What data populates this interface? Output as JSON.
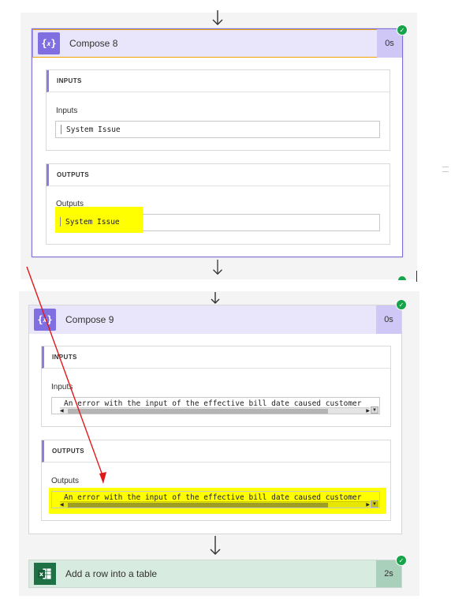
{
  "compose8": {
    "title": "Compose 8",
    "duration": "0s",
    "inputs_header": "INPUTS",
    "inputs_label": "Inputs",
    "inputs_value": "System Issue",
    "outputs_header": "OUTPUTS",
    "outputs_label": "Outputs",
    "outputs_value": "System Issue"
  },
  "compose9": {
    "title": "Compose 9",
    "duration": "0s",
    "inputs_header": "INPUTS",
    "inputs_label": "Inputs",
    "inputs_value": "An error with the input of the effective bill date caused customer",
    "outputs_header": "OUTPUTS",
    "outputs_label": "Outputs",
    "outputs_value": "An error with the input of the effective bill date caused customer"
  },
  "excel_step": {
    "title": "Add a row into a table",
    "duration": "2s"
  },
  "icons": {
    "compose": "curly-braces-icon",
    "excel": "excel-icon",
    "status": "check-circle-icon",
    "connector": "arrow-down-icon"
  },
  "colors": {
    "compose_header": "#e9e6fb",
    "compose_icon": "#7f6fe0",
    "excel_header": "#d8ebe1",
    "excel_icon": "#1e7145",
    "success": "#17a34a",
    "highlight": "#ffff00",
    "annotation_arrow": "#e01818",
    "selection_border": "#f3a300"
  }
}
